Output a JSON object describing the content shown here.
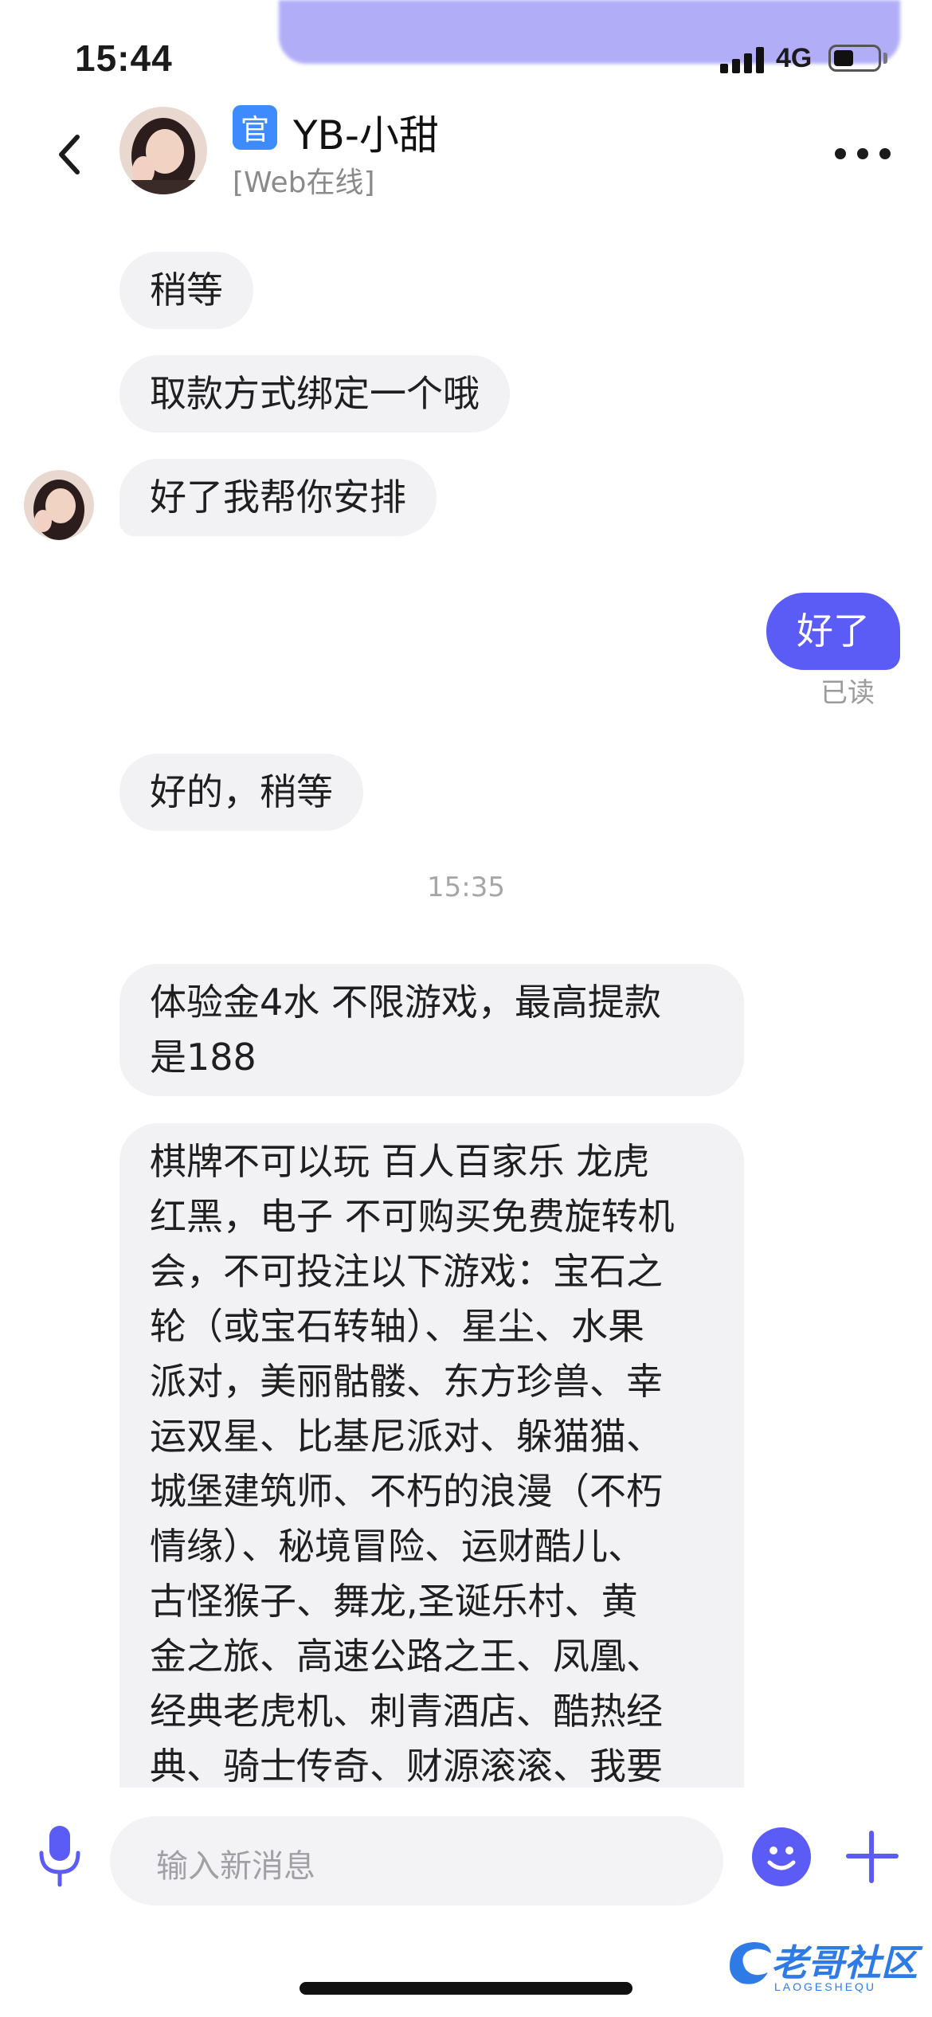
{
  "status_bar": {
    "time": "15:44",
    "network": "4G",
    "battery_level": 0.45
  },
  "header": {
    "official_badge": "官",
    "contact_name": "YB-小甜",
    "contact_status": "[Web在线]"
  },
  "messages": [
    {
      "side": "left",
      "text": "稍等"
    },
    {
      "side": "left",
      "text": "取款方式绑定一个哦"
    },
    {
      "side": "left",
      "text": "好了我帮你安排",
      "show_avatar": true
    },
    {
      "side": "right",
      "text": "好了",
      "read_receipt": "已读"
    },
    {
      "side": "left",
      "text": "好的，稍等"
    },
    {
      "type": "timestamp",
      "text": "15:35"
    },
    {
      "side": "left",
      "lines": [
        "体验金4水 不限游戏，最高提款",
        "是188"
      ]
    },
    {
      "side": "left",
      "lines": [
        "棋牌不可以玩 百人百家乐 龙虎",
        "红黑，电子 不可购买免费旋转机",
        "会，不可投注以下游戏：宝石之",
        "轮（或宝石转轴）、星尘、水果",
        "派对，美丽骷髅、东方珍兽、幸",
        "运双星、比基尼派对、躲猫猫、",
        "城堡建筑师、不朽的浪漫（不朽",
        "情缘）、秘境冒险、运财酷儿、",
        "古怪猴子、舞龙,圣诞乐村、黄",
        "金之旅、高速公路之王、凤凰、",
        "经典老虎机、刺青酒店、酷热经",
        "典、骑士传奇、财源滚滚、我要"
      ]
    }
  ],
  "composer": {
    "placeholder": "输入新消息"
  },
  "watermark": {
    "text": "老哥社区",
    "sub": "LAOGESHEQU"
  },
  "colors": {
    "accent": "#5b5bf6",
    "bubble_left": "#f2f2f4",
    "badge": "#3d8bff"
  },
  "icons": [
    "back-chevron-icon",
    "more-dots-icon",
    "microphone-icon",
    "emoji-icon",
    "plus-icon"
  ]
}
